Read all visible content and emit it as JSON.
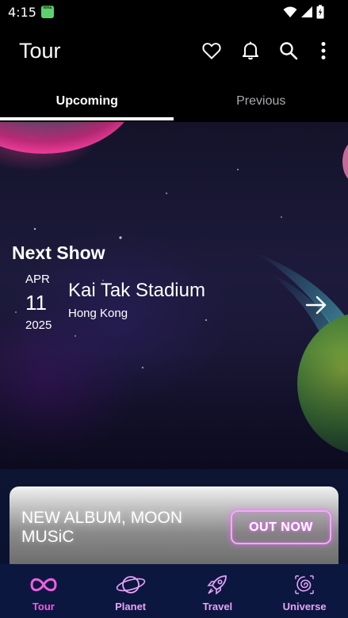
{
  "status_bar": {
    "time": "4:15",
    "app_icon_label": "WAE"
  },
  "app_bar": {
    "title": "Tour",
    "actions": [
      "heart-icon",
      "bell-icon",
      "search-icon",
      "more-vert-icon"
    ]
  },
  "tabs": [
    {
      "label": "Upcoming",
      "active": true
    },
    {
      "label": "Previous",
      "active": false
    }
  ],
  "next_show": {
    "heading": "Next Show",
    "month": "APR",
    "day": "11",
    "year": "2025",
    "venue": "Kai Tak Stadium",
    "city": "Hong Kong"
  },
  "promo": {
    "text": "NEW ALBUM, MOON MUSiC",
    "button_label": "OUT NOW"
  },
  "bottom_nav": [
    {
      "label": "Tour",
      "icon": "infinity-icon",
      "active": true
    },
    {
      "label": "Planet",
      "icon": "planet-icon",
      "active": false
    },
    {
      "label": "Travel",
      "icon": "rocket-icon",
      "active": false
    },
    {
      "label": "Universe",
      "icon": "galaxy-icon",
      "active": false
    }
  ],
  "colors": {
    "accent": "#ee5fe0",
    "nav_background": "#0c1740",
    "neon_border": "#f6a8ff"
  }
}
